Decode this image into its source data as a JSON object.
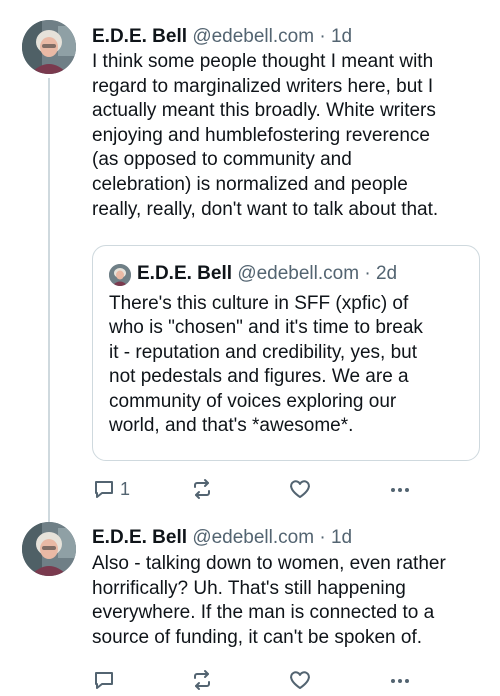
{
  "posts": [
    {
      "author_name": "E.D.E. Bell",
      "handle": "@edebell.com",
      "separator": "·",
      "time": "1d",
      "text": "I think some people thought I meant with\nregard to marginalized writers here, but I\nactually meant this broadly. White writers\nenjoying and humblefostering reverence\n(as opposed to community and\ncelebration) is normalized and people\nreally, really, don't want to talk about that.",
      "quote": {
        "author_name": "E.D.E. Bell",
        "handle": "@edebell.com",
        "separator": "·",
        "time": "2d",
        "text": "There's this culture in SFF (xpfic) of\nwho is \"chosen\" and it's time to break\nit - reputation and credibility, yes, but\nnot pedestals and figures. We are a\ncommunity of voices exploring our\nworld, and that's *awesome*."
      },
      "actions": {
        "reply_count": "1",
        "repost_count": "",
        "like_count": ""
      }
    },
    {
      "author_name": "E.D.E. Bell",
      "handle": "@edebell.com",
      "separator": "·",
      "time": "1d",
      "text": "Also - talking down to women, even rather\nhorrifically? Uh. That's still happening\neverywhere. If the man is connected to a\nsource of funding, it can't be spoken of.",
      "actions": {
        "reply_count": "",
        "repost_count": "",
        "like_count": ""
      }
    }
  ],
  "icons": {
    "reply": "reply-icon",
    "repost": "repost-icon",
    "like": "heart-icon",
    "more": "more-options-icon"
  },
  "colors": {
    "text": "#0f1419",
    "muted": "#536471",
    "border": "#cfd9de"
  }
}
